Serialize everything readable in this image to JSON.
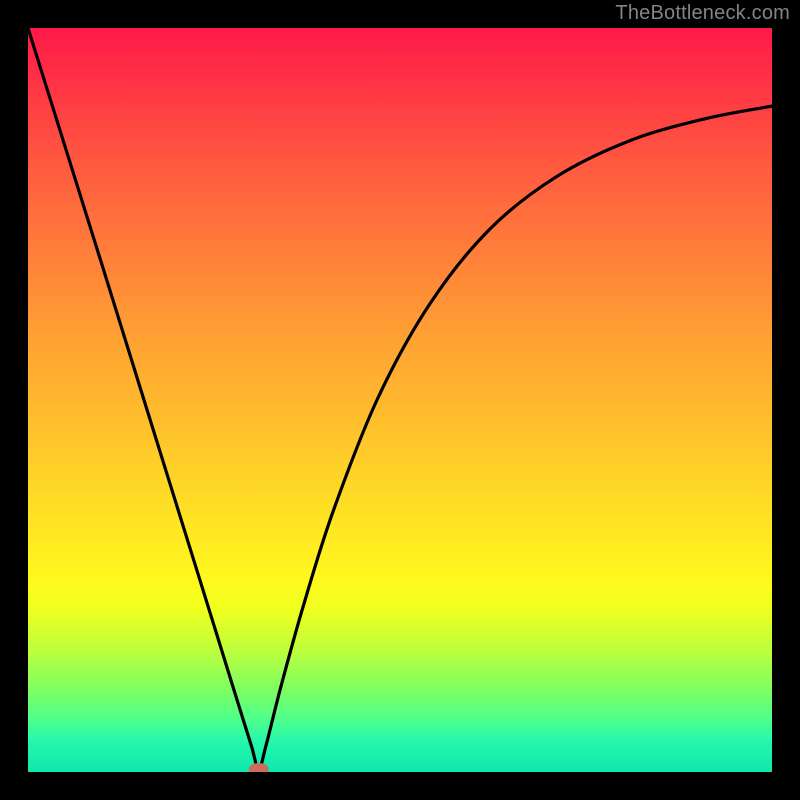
{
  "watermark": "TheBottleneck.com",
  "chart_data": {
    "type": "line",
    "title": "",
    "xlabel": "",
    "ylabel": "",
    "xlim": [
      0,
      1
    ],
    "ylim": [
      0,
      1
    ],
    "minimum_x": 0.31,
    "series": [
      {
        "name": "curve",
        "x": [
          0.0,
          0.05,
          0.1,
          0.15,
          0.2,
          0.25,
          0.28,
          0.3,
          0.31,
          0.32,
          0.34,
          0.37,
          0.41,
          0.47,
          0.54,
          0.62,
          0.71,
          0.81,
          0.91,
          1.0
        ],
        "values": [
          1.0,
          0.84,
          0.68,
          0.519,
          0.358,
          0.197,
          0.1,
          0.036,
          0.004,
          0.036,
          0.115,
          0.223,
          0.35,
          0.502,
          0.629,
          0.729,
          0.8,
          0.849,
          0.878,
          0.895
        ]
      }
    ],
    "marker": {
      "x": 0.31,
      "y": 0.004,
      "color": "#cd6b5f"
    }
  }
}
